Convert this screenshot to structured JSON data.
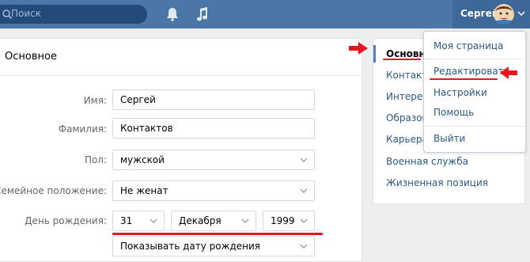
{
  "header": {
    "search_placeholder": "Поиск",
    "user_name": "Сергей"
  },
  "main": {
    "title": "Основное",
    "fields": {
      "first_name_label": "Имя:",
      "first_name_value": "Сергей",
      "last_name_label": "Фамилия:",
      "last_name_value": "Контактов",
      "gender_label": "Пол:",
      "gender_value": "мужской",
      "marital_label": "Семейное положение:",
      "marital_value": "Не женат",
      "birthday_label": "День рождения:",
      "birth_day": "31",
      "birth_month": "Декабря",
      "birth_year": "1999",
      "birthday_visibility": "Показывать дату рождения"
    }
  },
  "side_menu": {
    "items": [
      "Основное",
      "Контакты",
      "Интересы",
      "Образование",
      "Карьера",
      "Военная служба",
      "Жизненная позиция"
    ],
    "active_index": 0
  },
  "dropdown": {
    "items": [
      "Моя страница",
      "Редактировать",
      "Настройки",
      "Помощь",
      "Выйти"
    ]
  },
  "colors": {
    "header": "#4a76a8",
    "link": "#2a5885",
    "annotation": "#e8141e"
  }
}
